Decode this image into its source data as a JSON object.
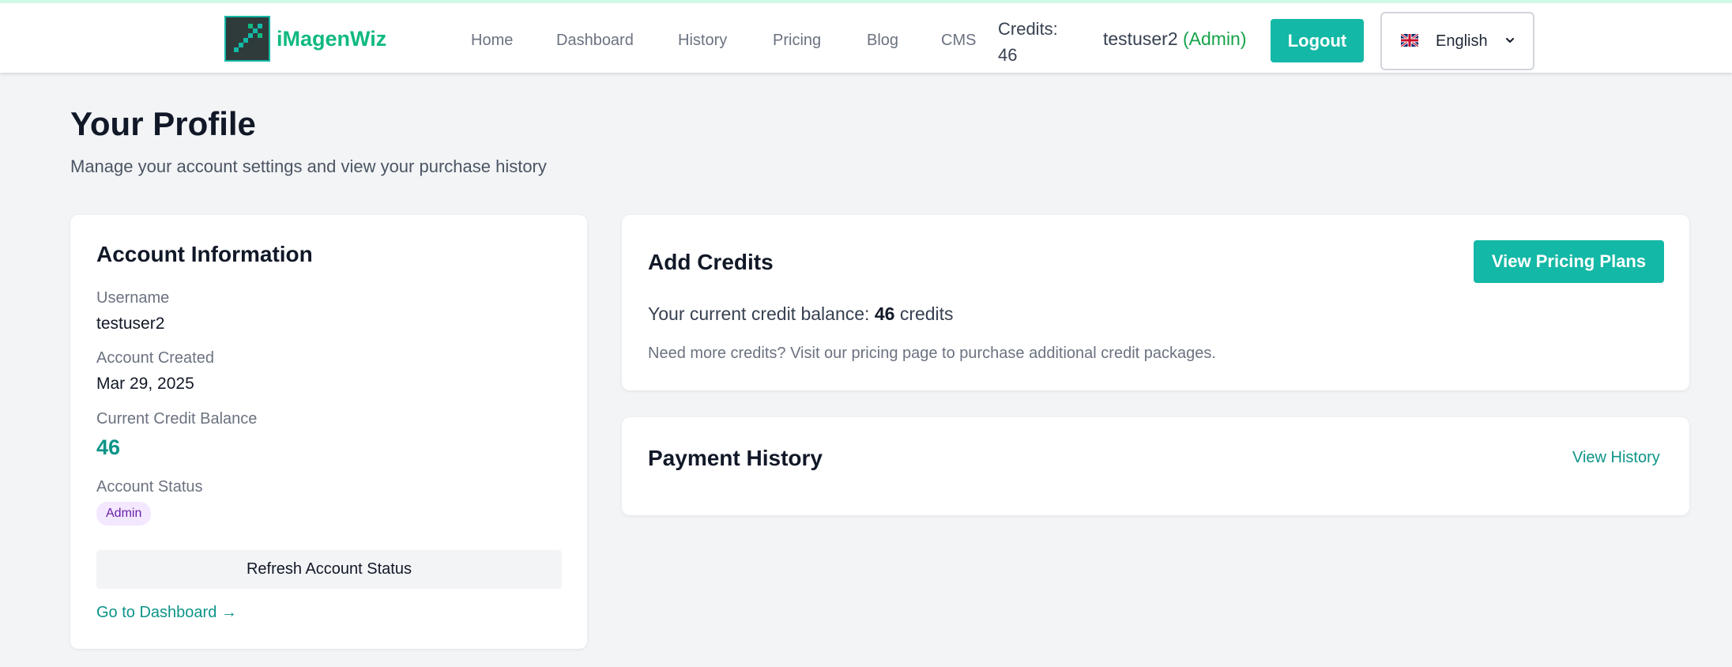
{
  "brand": {
    "name": "iMagenWiz"
  },
  "nav": {
    "links": [
      "Home",
      "Dashboard",
      "History",
      "Pricing",
      "Blog",
      "CMS"
    ],
    "credits_label": "Credits:",
    "credits_value": "46",
    "username": "testuser2",
    "role": "(Admin)",
    "logout_label": "Logout",
    "language": {
      "flag": "uk-flag-icon",
      "label": "English"
    }
  },
  "header": {
    "title": "Your Profile",
    "subtitle": "Manage your account settings and view your purchase history"
  },
  "account": {
    "title": "Account Information",
    "username_label": "Username",
    "username_value": "testuser2",
    "created_label": "Account Created",
    "created_value": "Mar 29, 2025",
    "balance_label": "Current Credit Balance",
    "balance_value": "46",
    "status_label": "Account Status",
    "status_badge": "Admin",
    "refresh_label": "Refresh Account Status",
    "dashboard_link": "Go to Dashboard →"
  },
  "add_credits": {
    "title": "Add Credits",
    "pricing_button": "View Pricing Plans",
    "balance_prefix": "Your current credit balance:",
    "balance_amount": "46",
    "balance_suffix": "credits",
    "note": "Need more credits? Visit our pricing page to purchase additional credit packages."
  },
  "payment_history": {
    "title": "Payment History",
    "view_link": "View History"
  },
  "colors": {
    "accent": "#14b8a6",
    "brand_text": "#10b981",
    "link": "#0d9488",
    "admin_green": "#16a34a",
    "badge_bg": "#f3e8ff",
    "badge_text": "#6b21a8",
    "page_bg": "#f3f4f6"
  }
}
